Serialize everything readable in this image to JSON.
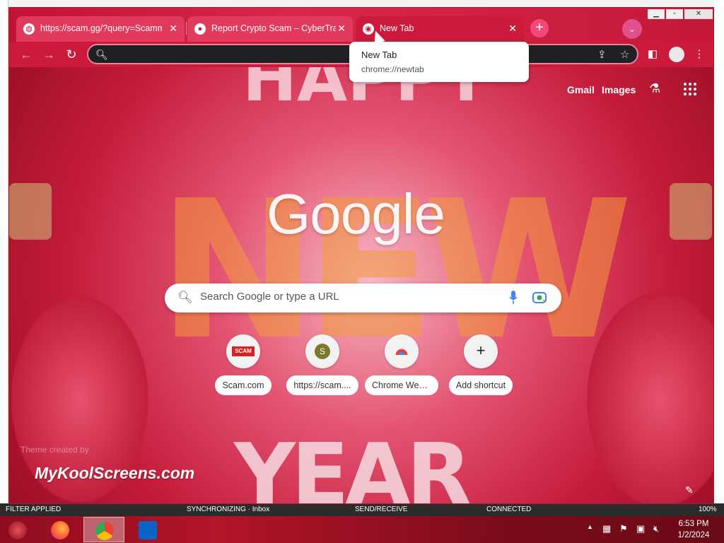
{
  "browser": {
    "tabs": [
      {
        "title": "https://scam.gg/?query=Scamm",
        "active": false,
        "favicon": "globe-icon"
      },
      {
        "title": "Report Crypto Scam – CyberTrail",
        "active": false,
        "favicon": "page-icon"
      },
      {
        "title": "New Tab",
        "active": true,
        "favicon": "chrome-icon"
      }
    ],
    "omnibox": {
      "value": "",
      "placeholder": ""
    },
    "tooltip": {
      "title": "New Tab",
      "url": "chrome://newtab"
    }
  },
  "ntp": {
    "links": {
      "gmail": "Gmail",
      "images": "Images"
    },
    "logo": "Google",
    "search_placeholder": "Search Google or type a URL",
    "shortcuts": [
      {
        "label": "Scam.com",
        "icon": "scam-logo-icon",
        "icon_text": "SCAM"
      },
      {
        "label": "https://scam....",
        "icon": "letter-s-icon",
        "icon_text": "S"
      },
      {
        "label": "Chrome Web ...",
        "icon": "chrome-web-store-icon",
        "icon_text": ""
      },
      {
        "label": "Add shortcut",
        "icon": "add-icon",
        "icon_text": "+"
      }
    ],
    "theme_credit_small": "Theme created by",
    "theme_credit_big": "MyKoolScreens.com",
    "background_text": {
      "top": "HAPPY",
      "middle": "NEW",
      "bottom": "YEAR"
    }
  },
  "outlook_status": {
    "filter": "FILTER APPLIED",
    "sync": "SYNCHRONIZING · Inbox",
    "sendrecv": "SEND/RECEIVE",
    "connected": "CONNECTED",
    "zoom": "100%"
  },
  "taskbar": {
    "apps": [
      {
        "name": "firefox-icon",
        "active": false
      },
      {
        "name": "chrome-icon",
        "active": true
      },
      {
        "name": "outlook-icon",
        "active": false
      }
    ],
    "time": "6:53 PM",
    "date": "1/2/2024"
  },
  "colors": {
    "theme_accent": "#cc1a3a",
    "tab_active": "#cc1a3a"
  }
}
